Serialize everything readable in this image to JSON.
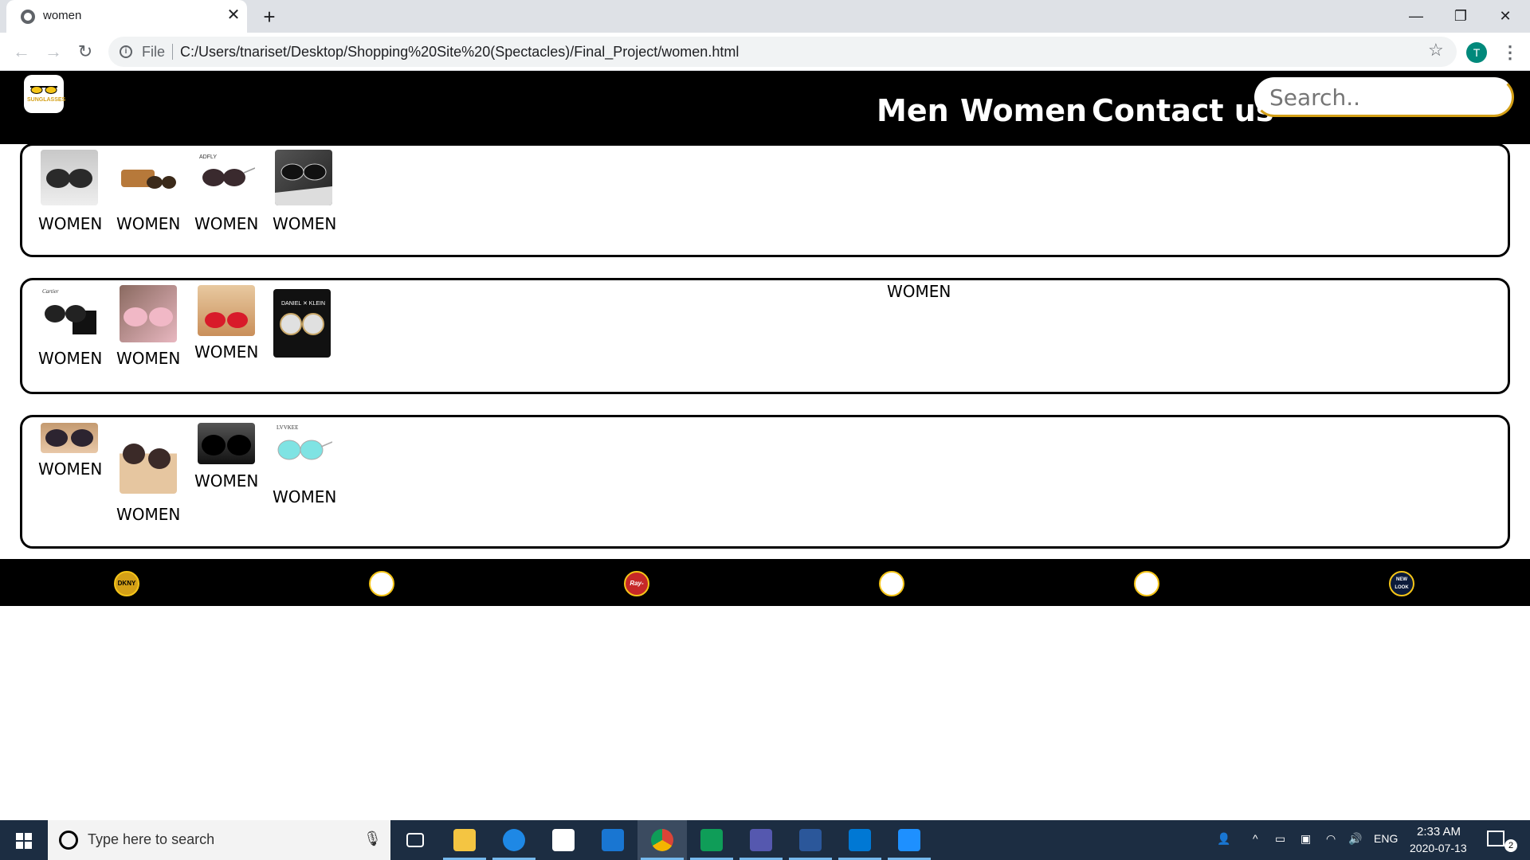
{
  "browser": {
    "tab_title": "women",
    "tab_close": "✕",
    "new_tab": "+",
    "file_label": "File",
    "url": "C:/Users/tnariset/Desktop/Shopping%20Site%20(Spectacles)/Final_Project/women.html",
    "profile_initial": "T",
    "window_controls": {
      "minimize": "—",
      "restore": "❐",
      "close": "✕"
    }
  },
  "site": {
    "logo_text": "SUNGLASSES",
    "nav": {
      "men": "Men",
      "women": "Women",
      "contact": "Contact us"
    },
    "search_placeholder": "Search.."
  },
  "rows": [
    {
      "products": [
        {
          "label": "WOMEN"
        },
        {
          "label": "WOMEN"
        },
        {
          "label": "WOMEN"
        },
        {
          "label": "WOMEN"
        }
      ]
    },
    {
      "products": [
        {
          "label": "WOMEN"
        },
        {
          "label": "WOMEN"
        },
        {
          "label": "WOMEN"
        },
        {
          "label": "WOMEN"
        }
      ]
    },
    {
      "products": [
        {
          "label": "WOMEN"
        },
        {
          "label": "WOMEN"
        },
        {
          "label": "WOMEN"
        },
        {
          "label": "WOMEN"
        }
      ]
    }
  ],
  "brands": [
    "DKNY",
    "",
    "Ray-Ban",
    "",
    "",
    "NEW LOOK"
  ],
  "taskbar": {
    "search_placeholder": "Type here to search",
    "language": "ENG",
    "time": "2:33 AM",
    "date": "2020-07-13",
    "notification_count": "2"
  },
  "colors": {
    "accent_gold": "#d4a017",
    "header_bg": "#000000",
    "taskbar_bg": "#1c2d42"
  }
}
